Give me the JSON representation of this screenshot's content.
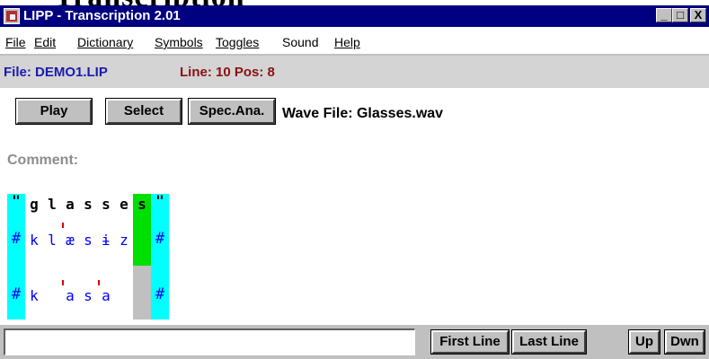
{
  "window": {
    "title": "LIPP - Transcription 2.01",
    "controls": [
      "_",
      "□",
      "X"
    ]
  },
  "menu": [
    "File",
    "Edit",
    "Dictionary",
    "Symbols",
    "Toggles",
    "Sound",
    "Help"
  ],
  "fileinfo": {
    "file": "File: DEMO1.LIP",
    "line_pos": "Line: 10  Pos: 8"
  },
  "toolbar": {
    "play": "Play",
    "select": "Select",
    "spec": "Spec.Ana.",
    "wave": "Wave File: Glasses.wav"
  },
  "comment_label": "Comment:",
  "transcription": {
    "orthography": [
      "\"",
      "g",
      "l",
      "a",
      "s",
      "s",
      "e",
      "s",
      "\""
    ],
    "target": [
      "#",
      "k",
      "l",
      "æ",
      "s",
      "ɨ",
      "z",
      "#"
    ],
    "realized": [
      "#",
      "k",
      "a",
      "s",
      "a",
      "#"
    ]
  },
  "colors": {
    "titlebar": "#000080",
    "boundary": "#00ffff",
    "current": "#00e000",
    "stress": "#e00000",
    "filename": "#1a1ab0",
    "position": "#8b1010"
  },
  "bottom": {
    "input_value": "",
    "first_line": "First Line",
    "last_line": "Last Line",
    "up": "Up",
    "down": "Dwn"
  }
}
